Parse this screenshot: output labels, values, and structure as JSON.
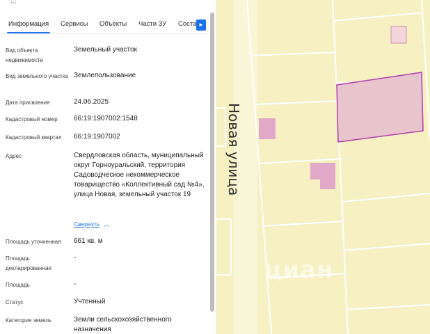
{
  "colors": {
    "accent": "#1a73e8",
    "map_background": "#f6f0c2",
    "map_lines": "#ffffff",
    "parcel_fill": "#e8c4cc",
    "parcel_selected_stroke": "#b03ab0",
    "building_fill": "#e2a8c8"
  },
  "header": {
    "favorite_icon": "star-outline-icon"
  },
  "tabs": [
    {
      "label": "Информация",
      "active": true
    },
    {
      "label": "Сервисы",
      "active": false
    },
    {
      "label": "Объекты",
      "active": false
    },
    {
      "label": "Части ЗУ",
      "active": false
    },
    {
      "label": "Соста",
      "active": false
    }
  ],
  "tabs_next_icon": "chevron-right-icon",
  "rows": [
    {
      "label": "Вид объекта недвижимости",
      "value": "Земельный участок"
    },
    {
      "label": "Вид земельного участка",
      "value": "Землепользование"
    },
    {
      "label": "Дата присвоения",
      "value": "24.06.2025"
    },
    {
      "label": "Кадастровый номер",
      "value": "66:19:1907002:1548"
    },
    {
      "label": "Кадастровый квартал",
      "value": "66:19:1907002"
    },
    {
      "label": "Адрес",
      "value": "Свердловская область, муниципальный округ Горноуральский, территория Садоводческое некоммерческое товарищество «Коллективный сад №4», улица Новая, земельный участок 19"
    },
    {
      "label": "Площадь уточненная",
      "value": "661 кв. м"
    },
    {
      "label": "Площадь декларированная",
      "value": "-"
    },
    {
      "label": "Площадь",
      "value": "-"
    },
    {
      "label": "Статус",
      "value": "Учтенный"
    },
    {
      "label": "Категория земель",
      "value": "Земли сельскохозяйственного назначения"
    }
  ],
  "collapse_link": "Свернуть",
  "map": {
    "street_label": "Новая улица",
    "watermark": "циан"
  }
}
